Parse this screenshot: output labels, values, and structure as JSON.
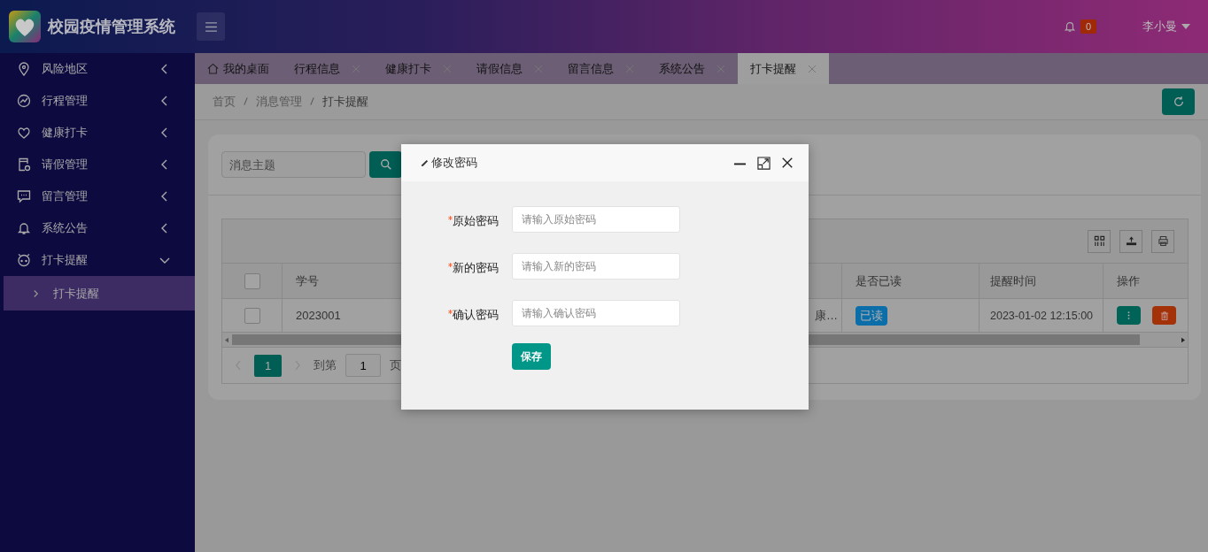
{
  "app": {
    "title": "校园疫情管理系统",
    "notification_count": "0",
    "user": "李小曼"
  },
  "sidebar": {
    "items": [
      {
        "label": "风险地区",
        "kind": "pin",
        "expanded": false
      },
      {
        "label": "行程管理",
        "kind": "trend",
        "expanded": false
      },
      {
        "label": "健康打卡",
        "kind": "heart",
        "expanded": false
      },
      {
        "label": "请假管理",
        "kind": "form",
        "expanded": false
      },
      {
        "label": "留言管理",
        "kind": "message",
        "expanded": false
      },
      {
        "label": "系统公告",
        "kind": "bell",
        "expanded": false
      },
      {
        "label": "打卡提醒",
        "kind": "clock",
        "expanded": true,
        "children": [
          {
            "label": "打卡提醒",
            "selected": true
          }
        ]
      }
    ]
  },
  "tabs": [
    {
      "label": "我的桌面",
      "kind": "home",
      "selected": false
    },
    {
      "label": "行程信息",
      "kind": "page",
      "selected": false
    },
    {
      "label": "健康打卡",
      "kind": "page",
      "selected": false
    },
    {
      "label": "请假信息",
      "kind": "page",
      "selected": false
    },
    {
      "label": "留言信息",
      "kind": "page",
      "selected": false
    },
    {
      "label": "系统公告",
      "kind": "page",
      "selected": false
    },
    {
      "label": "打卡提醒",
      "kind": "page",
      "selected": true
    }
  ],
  "breadcrumb": [
    "首页",
    "消息管理",
    "打卡提醒"
  ],
  "search": {
    "placeholder": "消息主题"
  },
  "table": {
    "header_checked": false,
    "columns": [
      "学号",
      "是否已读",
      "提醒时间",
      "操作"
    ],
    "rows": [
      {
        "checked": false,
        "student_id": "2023001",
        "column_3": "康…",
        "read_label": "已读",
        "read": true,
        "remind_time": "2023-01-02 12:15:00"
      }
    ]
  },
  "pagination": {
    "current": "1",
    "goto_label": "到第",
    "goto_value": "1",
    "page_label": "页"
  },
  "dialog": {
    "title": "修改密码",
    "fields": [
      {
        "label": "原始密码",
        "required": true,
        "placeholder": "请输入原始密码"
      },
      {
        "label": "新的密码",
        "required": true,
        "placeholder": "请输入新的密码"
      },
      {
        "label": "确认密码",
        "required": true,
        "placeholder": "请输入确认密码"
      }
    ],
    "save_button": "保存"
  }
}
